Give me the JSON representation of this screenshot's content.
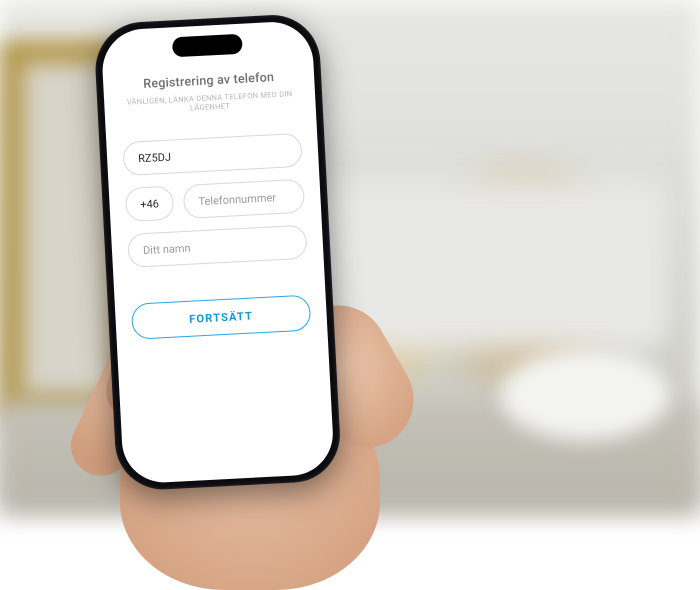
{
  "form": {
    "title": "Registrering av telefon",
    "subtitle": "Vänligen, länka denna telefon med din lägenhet",
    "code_value": "RZ5DJ",
    "dial_code": "+46",
    "phone_placeholder": "Telefonnummer",
    "name_placeholder": "Ditt namn",
    "submit_label": "Fortsätt"
  },
  "colors": {
    "accent": "#1298d8",
    "border": "#d8d8dc"
  }
}
